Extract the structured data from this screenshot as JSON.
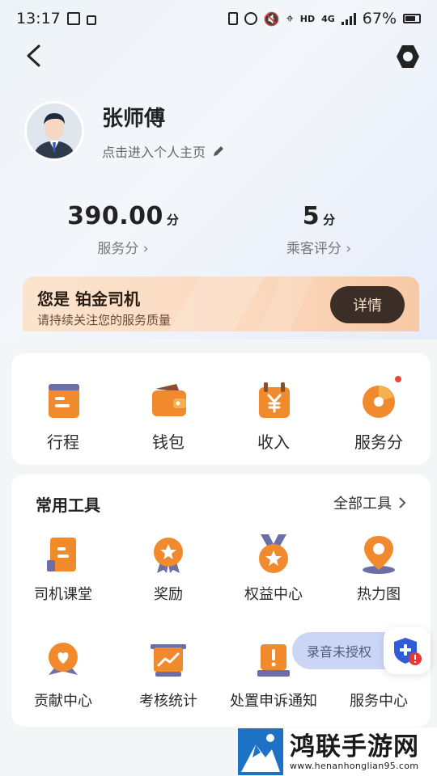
{
  "status_bar": {
    "time": "13:17",
    "hd": "HD",
    "network": "4G",
    "battery": "67%"
  },
  "profile": {
    "name": "张师傅",
    "subtitle": "点击进入个人主页"
  },
  "stats": [
    {
      "value": "390.00",
      "unit": "分",
      "label": "服务分 ›"
    },
    {
      "value": "5",
      "unit": "分",
      "label": "乘客评分 ›"
    }
  ],
  "level_banner": {
    "title": "您是 铂金司机",
    "subtitle": "请持续关注您的服务质量",
    "button": "详情"
  },
  "quick_menu": [
    {
      "label": "行程",
      "icon": "trip-icon"
    },
    {
      "label": "钱包",
      "icon": "wallet-icon"
    },
    {
      "label": "收入",
      "icon": "income-icon"
    },
    {
      "label": "服务分",
      "icon": "service-score-icon"
    }
  ],
  "tools": {
    "title": "常用工具",
    "all_label": "全部工具",
    "items": [
      {
        "label": "司机课堂",
        "icon": "classroom-icon"
      },
      {
        "label": "奖励",
        "icon": "reward-icon"
      },
      {
        "label": "权益中心",
        "icon": "benefits-icon"
      },
      {
        "label": "热力图",
        "icon": "heatmap-icon"
      },
      {
        "label": "贡献中心",
        "icon": "contribution-icon"
      },
      {
        "label": "考核统计",
        "icon": "assessment-icon"
      },
      {
        "label": "处置申诉通知",
        "icon": "appeal-icon"
      },
      {
        "label": "服务中心",
        "icon": "service-center-icon"
      }
    ]
  },
  "recording_notice": "录音未授权",
  "watermark": {
    "title": "鸿联手游网",
    "url": "www.henanhonglian95.com"
  },
  "colors": {
    "accent_orange": "#f08a2c",
    "light_orange": "#f7b04e",
    "dark_button": "#3a2e27"
  }
}
